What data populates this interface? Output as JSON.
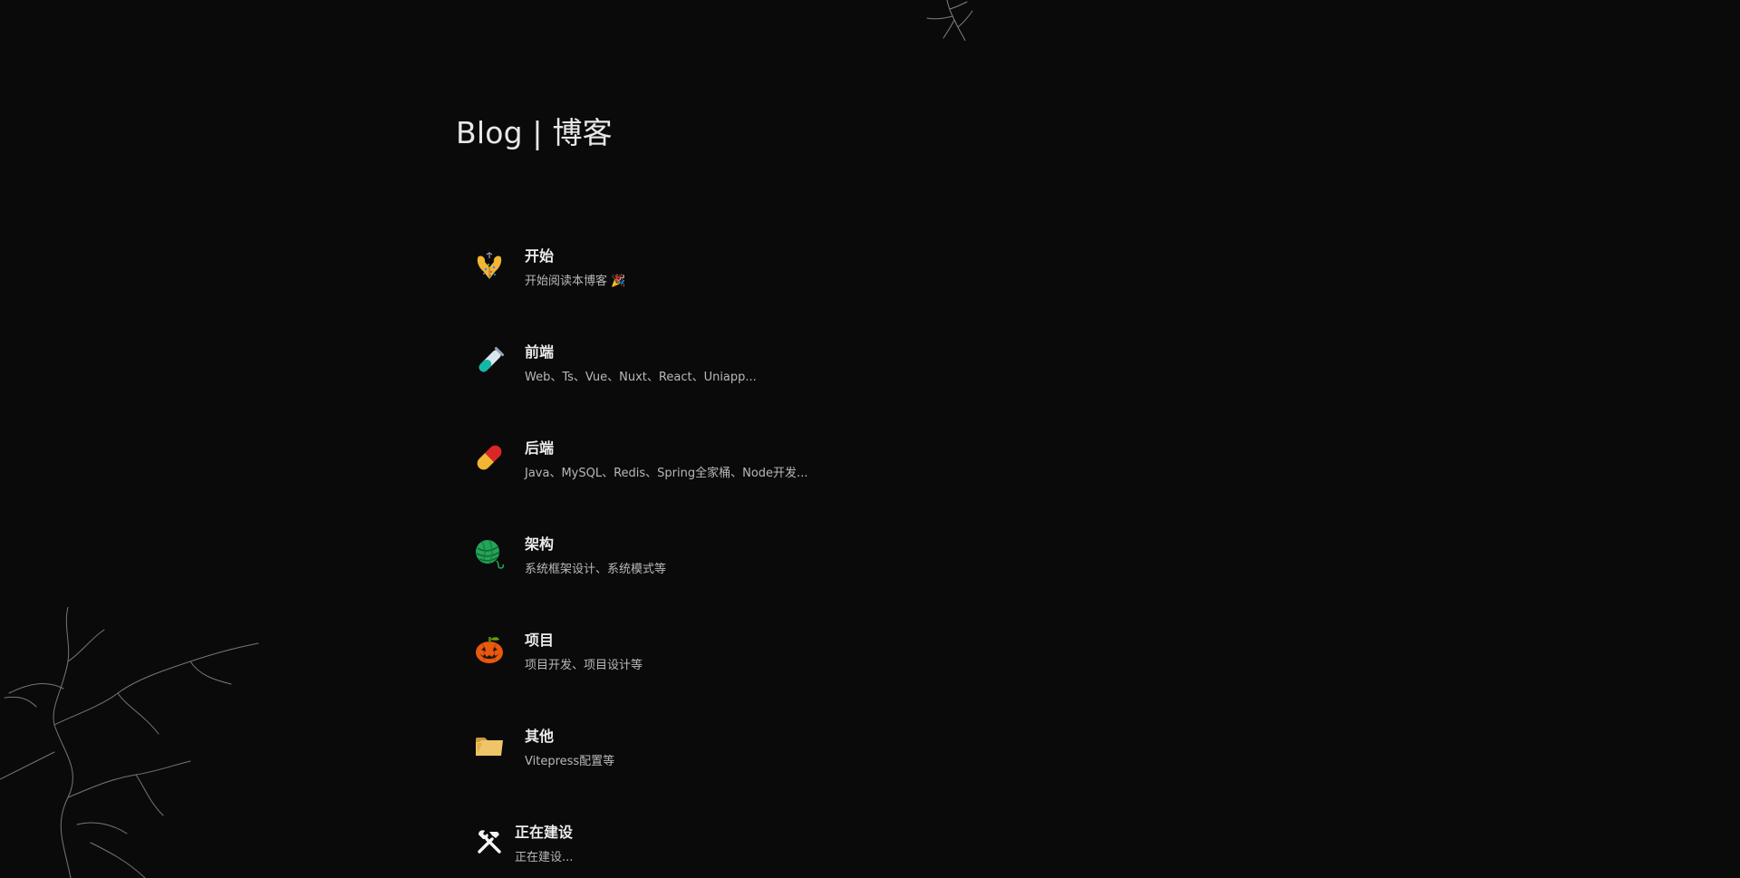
{
  "page": {
    "title": "Blog | 博客"
  },
  "categories": [
    {
      "name": "开始",
      "desc": "开始阅读本博客 🎉",
      "icon": "confetti-icon"
    },
    {
      "name": "前端",
      "desc": "Web、Ts、Vue、Nuxt、React、Uniapp...",
      "icon": "test-tube-icon"
    },
    {
      "name": "后端",
      "desc": "Java、MySQL、Redis、Spring全家桶、Node开发...",
      "icon": "pill-icon"
    },
    {
      "name": "架构",
      "desc": "系统框架设计、系统模式等",
      "icon": "yarn-icon"
    },
    {
      "name": "项目",
      "desc": "项目开发、项目设计等",
      "icon": "jack-o-lantern-icon"
    },
    {
      "name": "其他",
      "desc": "Vitepress配置等",
      "icon": "folder-icon"
    },
    {
      "name": "正在建设",
      "desc": "正在建设...",
      "icon": "tools-icon"
    }
  ],
  "colors": {
    "background": "#0a0a0b",
    "title": "#e8e8e8",
    "item_name": "#ececec",
    "item_desc": "#b8b8b8"
  }
}
